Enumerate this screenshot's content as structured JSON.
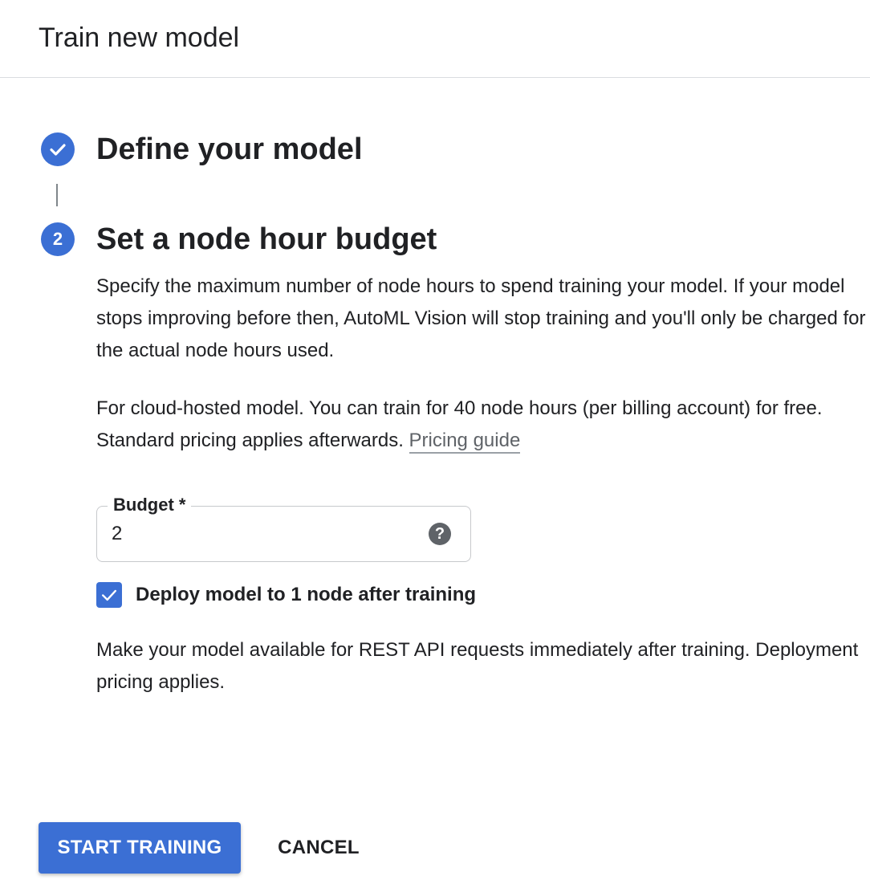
{
  "header": {
    "title": "Train new model"
  },
  "steps": [
    {
      "status": "complete",
      "icon": "check-icon",
      "title": "Define your model"
    },
    {
      "status": "active",
      "number": "2",
      "title": "Set a node hour budget"
    }
  ],
  "budget_step": {
    "description": "Specify the maximum number of node hours to spend training your model. If your model stops improving before then, AutoML Vision will stop training and you'll only be charged for the actual node hours used.",
    "free_tier_text": "For cloud-hosted model. You can train for 40 node hours (per billing account) for free. Standard pricing applies afterwards.",
    "pricing_link": "Pricing guide",
    "budget_field": {
      "label": "Budget *",
      "value": "2",
      "help_icon": "help-circle-icon"
    },
    "deploy_checkbox": {
      "checked": true,
      "label": "Deploy model to 1 node after training"
    },
    "deploy_description": "Make your model available for REST API requests immediately after training. Deployment pricing applies."
  },
  "actions": {
    "start_label": "START TRAINING",
    "cancel_label": "CANCEL"
  },
  "colors": {
    "accent": "#3b6fd4",
    "text": "#202124",
    "divider": "#dadce0"
  }
}
